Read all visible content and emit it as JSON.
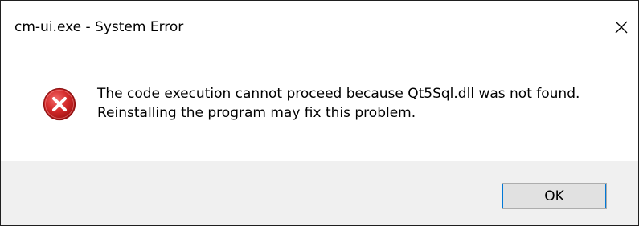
{
  "window": {
    "title": "cm-ui.exe - System Error",
    "close_icon": "close-icon"
  },
  "message": {
    "line1": "The code execution cannot proceed because Qt5Sql.dll was not found.",
    "line2": "Reinstalling the program may fix this problem.",
    "icon": "error-icon"
  },
  "buttons": {
    "ok_label": "OK"
  },
  "colors": {
    "error_red": "#d32f2f",
    "footer_bg": "#f0f0f0",
    "button_bg": "#e1e1e1",
    "button_focus": "#0078d7"
  }
}
